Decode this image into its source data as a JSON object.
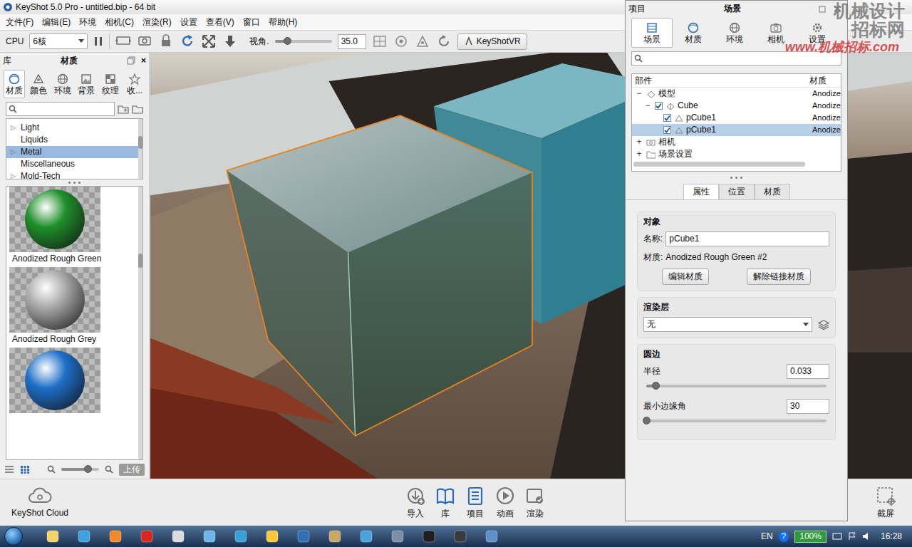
{
  "window": {
    "title": "KeyShot 5.0 Pro - untitled.bip  - 64 bit"
  },
  "menu": [
    "文件(F)",
    "编辑(E)",
    "环境",
    "相机(C)",
    "渲染(R)",
    "设置",
    "查看(V)",
    "窗口",
    "帮助(H)"
  ],
  "toolbar": {
    "cpu_label": "CPU",
    "cpu_value": "6核",
    "view_label": "视角.",
    "view_value": "35.0",
    "view_level": 0.22,
    "vr_button": "KeyShotVR"
  },
  "library": {
    "title": "库",
    "heading": "材质",
    "close": "×",
    "tabs": [
      {
        "label": "材质",
        "selected": true
      },
      {
        "label": "颜色",
        "selected": false
      },
      {
        "label": "环境",
        "selected": false
      },
      {
        "label": "背景",
        "selected": false
      },
      {
        "label": "纹理",
        "selected": false
      },
      {
        "label": "收...",
        "selected": false
      }
    ],
    "tree": [
      {
        "label": "Light",
        "arrow": "▷",
        "selected": false
      },
      {
        "label": "Liquids",
        "selected": false
      },
      {
        "label": "Metal",
        "arrow": "▷",
        "selected": true
      },
      {
        "label": "Miscellaneous",
        "selected": false
      },
      {
        "label": "Mold-Tech",
        "arrow": "▷",
        "selected": false
      }
    ],
    "materials": [
      {
        "label": "Anodized Rough Green",
        "color": "#1f8f2a"
      },
      {
        "label": "Anodized Rough Grey",
        "color": "#a8a8a8"
      },
      {
        "color": "#1e6fc8"
      }
    ],
    "zoom_level": 0.7,
    "upload": "上传"
  },
  "project": {
    "title": "项目",
    "heading": "场景",
    "tabs": [
      {
        "label": "场景",
        "selected": true
      },
      {
        "label": "材质",
        "selected": false
      },
      {
        "label": "环境",
        "selected": false
      },
      {
        "label": "相机",
        "selected": false
      },
      {
        "label": "设置",
        "selected": false
      }
    ],
    "tree": {
      "columns": [
        "部件",
        "材质"
      ],
      "rows": [
        {
          "kind": "model",
          "toggle": "−",
          "label": "模型",
          "material": "Anodize",
          "depth": 0,
          "selected": false
        },
        {
          "kind": "group",
          "toggle": "−",
          "checked": true,
          "label": "Cube",
          "material": "Anodize",
          "depth": 1,
          "selected": false
        },
        {
          "kind": "mesh",
          "checked": true,
          "label": "pCube1",
          "material": "Anodize",
          "depth": 2,
          "selected": false
        },
        {
          "kind": "mesh",
          "checked": true,
          "label": "pCube1",
          "material": "Anodize",
          "depth": 2,
          "selected": true
        },
        {
          "kind": "camera",
          "toggle": "+",
          "label": "相机",
          "depth": 0,
          "selected": false
        },
        {
          "kind": "folder",
          "toggle": "+",
          "label": "场景设置",
          "depth": 0,
          "selected": false
        }
      ]
    },
    "subtabs": [
      {
        "label": "属性",
        "selected": true
      },
      {
        "label": "位置",
        "selected": false
      },
      {
        "label": "材质",
        "selected": false
      }
    ],
    "object": {
      "title": "对象",
      "name_label": "名称:",
      "name_value": "pCube1",
      "material_label": "材质:",
      "material_value": "Anodized Rough Green #2",
      "buttons": [
        "编辑材质",
        "解除链接材质"
      ]
    },
    "render_layer": {
      "title": "渲染层",
      "value": "无"
    },
    "round_edges": {
      "title": "圆边",
      "sliders": [
        {
          "label": "半径",
          "value": "0.033",
          "level": 0.05
        },
        {
          "label": "最小边缘角",
          "value": "30",
          "level": 0.0
        }
      ]
    }
  },
  "bottom": {
    "cloud": "KeyShot Cloud",
    "buttons": [
      "导入",
      "库",
      "项目",
      "动画",
      "渲染"
    ],
    "screenshot": "截屏"
  },
  "taskbar": {
    "language": "EN",
    "help": "?",
    "battery": "100%",
    "time": "16:28"
  },
  "watermark": [
    "机械设计",
    "招标网",
    "www.机械招标.com"
  ]
}
